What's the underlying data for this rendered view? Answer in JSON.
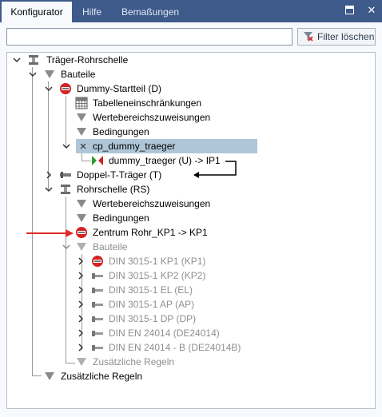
{
  "window": {
    "tabs": [
      {
        "label": "Konfigurator",
        "active": true
      },
      {
        "label": "Hilfe",
        "active": false
      },
      {
        "label": "Bemaßungen",
        "active": false
      }
    ],
    "colors": {
      "titlebar": "#3e5a8a",
      "selection": "#aec6d8",
      "annotation_red": "#e02828"
    }
  },
  "search": {
    "value": "",
    "placeholder": ""
  },
  "filter_button": {
    "label": "Filter löschen"
  },
  "tree": {
    "root": {
      "label": "Träger-Rohrschelle",
      "icon": "assembly-icon"
    },
    "bauteile": {
      "label": "Bauteile",
      "icon": "funnel-icon"
    },
    "dummy_startteil": {
      "label": "Dummy-Startteil (D)",
      "icon": "red-part-icon"
    },
    "tabelleneinschraenkungen": {
      "label": "Tabelleneinschränkungen",
      "icon": "table-icon"
    },
    "wertebereich1": {
      "label": "Wertebereichszuweisungen",
      "icon": "funnel-icon"
    },
    "bedingungen1": {
      "label": "Bedingungen",
      "icon": "funnel-icon"
    },
    "cp_dummy_traeger": {
      "label": "cp_dummy_traeger",
      "icon": "close-x-icon",
      "selected": true
    },
    "dummy_traeger_link": {
      "label": "dummy_traeger (U) -> IP1",
      "icon": "green-red-connector-icon"
    },
    "doppel_t_traeger": {
      "label": "Doppel-T-Träger (T)",
      "icon": "beam-part-icon"
    },
    "rohrschelle": {
      "label": "Rohrschelle (RS)",
      "icon": "assembly-icon"
    },
    "wertebereich2": {
      "label": "Wertebereichszuweisungen",
      "icon": "funnel-icon"
    },
    "bedingungen2": {
      "label": "Bedingungen",
      "icon": "funnel-icon"
    },
    "zentrum": {
      "label": "Zentrum Rohr_KP1 -> KP1",
      "icon": "red-part-icon"
    },
    "bauteile_sub": {
      "label": "Bauteile",
      "icon": "funnel-icon",
      "disabled": true
    },
    "din_items": [
      {
        "label": "DIN 3015-1 KP1 (KP1)",
        "icon": "red-part-icon"
      },
      {
        "label": "DIN 3015-1 KP2 (KP2)",
        "icon": "screw-part-icon"
      },
      {
        "label": "DIN 3015-1 EL (EL)",
        "icon": "screw-part-icon"
      },
      {
        "label": "DIN 3015-1 AP (AP)",
        "icon": "screw-part-icon"
      },
      {
        "label": "DIN 3015-1 DP (DP)",
        "icon": "screw-part-icon"
      },
      {
        "label": "DIN EN 24014 (DE24014)",
        "icon": "screw-part-icon"
      },
      {
        "label": "DIN EN 24014 - B (DE24014B)",
        "icon": "screw-part-icon"
      }
    ],
    "zusaetzliche_regeln_sub": {
      "label": "Zusätzliche Regeln",
      "icon": "funnel-icon",
      "disabled": true
    },
    "zusaetzliche_regeln": {
      "label": "Zusätzliche Regeln",
      "icon": "funnel-icon"
    }
  }
}
